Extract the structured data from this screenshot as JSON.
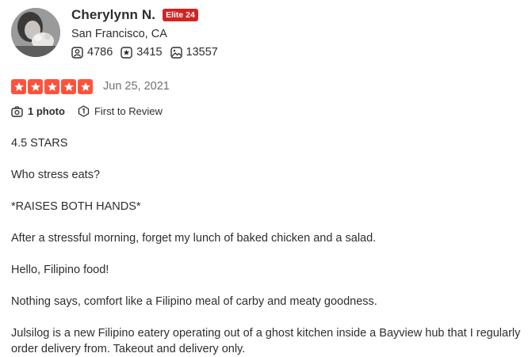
{
  "user": {
    "name": "Cherylynn N.",
    "elite_badge": "Elite 24",
    "location": "San Francisco, CA",
    "friends_count": "4786",
    "reviews_count": "3415",
    "photos_count": "13557"
  },
  "rating": {
    "stars": 5,
    "max": 5,
    "color": "#ff523d",
    "date": "Jun 25, 2021"
  },
  "meta": {
    "photo_label": "1 photo",
    "first_review_label": "First to Review"
  },
  "review": {
    "p1": "4.5 STARS",
    "p2": "Who stress eats?",
    "p3": "*RAISES BOTH HANDS*",
    "p4": "After a stressful morning, forget my lunch of baked chicken and a salad.",
    "p5": "Hello, Filipino food!",
    "p6": "Nothing says, comfort like a Filipino meal of carby and meaty goodness.",
    "p7_line1": "Julsilog is a new Filipino eatery operating out of a ghost kitchen inside a Bayview hub that I regularly",
    "p7_line2": "order delivery from. Takeout and delivery only."
  },
  "icons": {
    "friends": "friends-icon",
    "reviews": "review-star-icon",
    "photos": "photo-icon",
    "camera": "camera-icon",
    "first": "first-to-review-icon"
  }
}
